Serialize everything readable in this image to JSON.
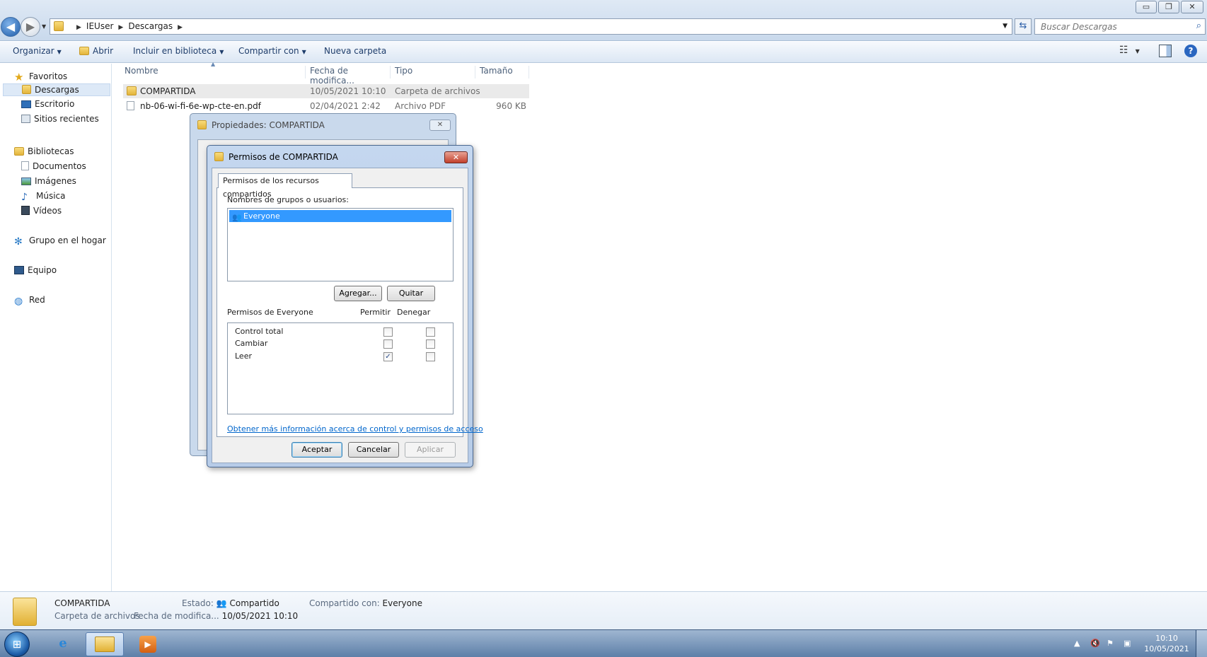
{
  "window": {
    "minimize_icon": "minimize-icon",
    "maximize_icon": "restore-icon",
    "close_icon": "close-icon",
    "min_glyph": "▭",
    "max_glyph": "❐",
    "close_glyph": "✕"
  },
  "address_bar": {
    "crumbs": [
      "IEUser",
      "Descargas"
    ],
    "search_placeholder": "Buscar Descargas",
    "refresh_glyph": "⇆",
    "search_glyph": "⌕",
    "back_glyph": "◀",
    "fwd_glyph": "▶"
  },
  "toolbar": {
    "organize": "Organizar",
    "open": "Abrir",
    "include_library": "Incluir en biblioteca",
    "share_with": "Compartir con",
    "new_folder": "Nueva carpeta",
    "help_glyph": "?"
  },
  "sidebar": {
    "favorites": "Favoritos",
    "downloads": "Descargas",
    "desktop": "Escritorio",
    "recent": "Sitios recientes",
    "libraries": "Bibliotecas",
    "documents": "Documentos",
    "pictures": "Imágenes",
    "music": "Música",
    "videos": "Vídeos",
    "homegroup": "Grupo en el hogar",
    "computer": "Equipo",
    "network": "Red"
  },
  "file_list": {
    "columns": {
      "name": "Nombre",
      "date": "Fecha de modifica...",
      "type": "Tipo",
      "size": "Tamaño"
    },
    "rows": [
      {
        "name": "COMPARTIDA",
        "date": "10/05/2021 10:10",
        "type": "Carpeta de archivos",
        "size": ""
      },
      {
        "name": "nb-06-wi-fi-6e-wp-cte-en.pdf",
        "date": "02/04/2021 2:42",
        "type": "Archivo PDF",
        "size": "960 KB"
      }
    ]
  },
  "props_dialog": {
    "title": "Propiedades: COMPARTIDA"
  },
  "perm_dialog": {
    "title": "Permisos de COMPARTIDA",
    "tab": "Permisos de los recursos compartidos",
    "users_label": "Nombres de grupos o usuarios:",
    "user": "Everyone",
    "add_button": "Agregar...",
    "remove_button": "Quitar",
    "perm_for": "Permisos de Everyone",
    "allow": "Permitir",
    "deny": "Denegar",
    "permissions": [
      {
        "name": "Control total",
        "allow": false,
        "deny": false
      },
      {
        "name": "Cambiar",
        "allow": false,
        "deny": false
      },
      {
        "name": "Leer",
        "allow": true,
        "deny": false
      }
    ],
    "link": "Obtener más información acerca de control y permisos de acceso",
    "ok": "Aceptar",
    "cancel": "Cancelar",
    "apply": "Aplicar",
    "check_glyph": "✓"
  },
  "details": {
    "name": "COMPARTIDA",
    "kind": "Carpeta de archivos",
    "state_label": "Estado:",
    "state_value": "Compartido",
    "shared_with_label": "Compartido con:",
    "shared_with_value": "Everyone",
    "modified_label": "Fecha de modifica...",
    "modified_value": "10/05/2021 10:10"
  },
  "taskbar": {
    "time": "10:10",
    "date": "10/05/2021",
    "ie_glyph": "e",
    "media_glyph": "▶"
  }
}
